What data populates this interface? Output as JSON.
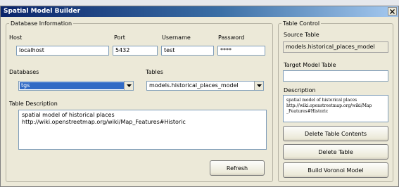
{
  "window": {
    "title": "Spatial Model Builder"
  },
  "database_info": {
    "legend": "Database Information",
    "host_label": "Host",
    "host_value": "localhost",
    "port_label": "Port",
    "port_value": "5432",
    "username_label": "Username",
    "username_value": "test",
    "password_label": "Password",
    "password_value": "****",
    "databases_label": "Databases",
    "databases_selected": "tgs",
    "tables_label": "Tables",
    "tables_selected": "models.historical_places_model",
    "table_description_label": "Table Description",
    "table_description_line1": "spatial model of historical places",
    "table_description_line2": "http://wiki.openstreetmap.org/wiki/Map_Features#Historic",
    "refresh_button": "Refresh"
  },
  "table_control": {
    "legend": "Table Control",
    "source_table_label": "Source Table",
    "source_table_value": "models.historical_places_model",
    "target_model_label": "Target Model Table",
    "target_model_value": "",
    "description_label": "Description",
    "description_line1": "spatial model of historical places",
    "description_line2": "http://wiki.openstreetmap.org/wiki/Map",
    "description_line3": "_Features#Historic",
    "delete_contents_button": "Delete Table Contents",
    "delete_table_button": "Delete Table",
    "build_voronoi_button": "Build Voronoi Model"
  },
  "icons": {
    "close": "close-icon",
    "dropdown": "chevron-down-icon"
  }
}
